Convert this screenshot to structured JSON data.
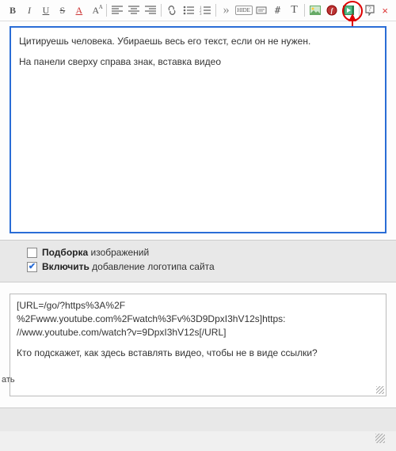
{
  "toolbar": {
    "bold": "B",
    "italic": "I",
    "underline": "U",
    "strike": "S",
    "fontcolor": "A",
    "fontsize": "A",
    "hide": "HIDE",
    "hash": "#",
    "text": "T"
  },
  "editor": {
    "line1": "Цитируешь человека. Убираешь весь его текст, если он не нужен.",
    "line2": "На панели сверху справа знак, вставка видео"
  },
  "options": {
    "opt1_bold": "Подборка",
    "opt1_rest": " изображений",
    "opt2_bold": "Включить",
    "opt2_rest": " добавление логотипа сайта"
  },
  "quote": {
    "line1": "[URL=/go/?https%3A%2F",
    "line2": "%2Fwww.youtube.com%2Fwatch%3Fv%3D9DpxI3hV12s]https:",
    "line3": "//www.youtube.com/watch?v=9DpxI3hV12s[/URL]",
    "line4": "Кто подскажет, как здесь вставлять видео, чтобы не в виде ссылки?"
  },
  "side": {
    "fragment": "ать"
  }
}
